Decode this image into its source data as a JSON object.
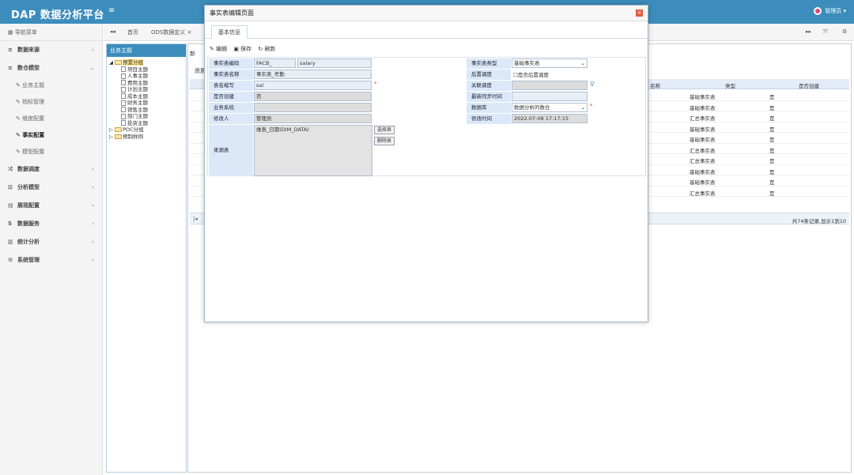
{
  "header": {
    "title": "DAP 数据分析平台",
    "menu_icon": "≡",
    "user": "管理员 ▾"
  },
  "sidebar": {
    "nav_label": "导航菜单",
    "items": [
      {
        "label": "数据来源",
        "icon": "≡"
      },
      {
        "label": "数仓模型",
        "icon": "≡"
      },
      {
        "label": "数据调度",
        "icon": "⤮"
      },
      {
        "label": "分析模型",
        "icon": "⊡"
      },
      {
        "label": "展现配置",
        "icon": "▤"
      },
      {
        "label": "数据服务",
        "icon": "S"
      },
      {
        "label": "统计分析",
        "icon": "▥"
      },
      {
        "label": "系统管理",
        "icon": "⚙"
      }
    ],
    "sub": [
      {
        "label": "业务主题"
      },
      {
        "label": "指标管理"
      },
      {
        "label": "维度配置"
      },
      {
        "label": "事实配置"
      },
      {
        "label": "模型配置"
      }
    ]
  },
  "tabs": {
    "nav_back": "◂◂",
    "home": "首页",
    "ods": "ODS数据定义 ×",
    "more": "▸▸",
    "expand": "⤧",
    "gear": "⚙"
  },
  "tree": {
    "header": "业务主题",
    "root": "预置分组",
    "children": [
      "项目主题",
      "人事主题",
      "费用主题",
      "计划主题",
      "成本主题",
      "财务主题",
      "销售主题",
      "部门主题",
      "投资主题"
    ],
    "poc": "POC分组",
    "sample": "预制样例"
  },
  "right": {
    "prefix_top": "新",
    "prefix_mid": "资质"
  },
  "grid": {
    "headers": {
      "name": "名称",
      "type": "类型",
      "summary": "是否创建"
    },
    "rows": [
      {
        "type": "基础事实表",
        "flag": "是"
      },
      {
        "type": "基础事实表",
        "flag": "是"
      },
      {
        "type": "汇总事实表",
        "flag": "是"
      },
      {
        "type": "基础事实表",
        "flag": "是"
      },
      {
        "type": "基础事实表",
        "flag": "是"
      },
      {
        "type": "汇总事实表",
        "flag": "是"
      },
      {
        "type": "汇总事实表",
        "flag": "是"
      },
      {
        "type": "基础事实表",
        "flag": "是"
      },
      {
        "type": "基础事实表",
        "flag": "是"
      },
      {
        "type": "汇总事实表",
        "flag": "是"
      }
    ],
    "pager_text": "共74条记录,显示1到10",
    "pager_first": "|◂"
  },
  "dialog": {
    "title": "事实表编辑页面",
    "close": "×",
    "tab": "基本信息",
    "toolbar": {
      "edit": "✎ 编辑",
      "save": "▣ 保存",
      "refresh": "↻ 刷新"
    },
    "labels": {
      "code": "事实表编码",
      "name": "事实表名称",
      "abbr": "表名缩写",
      "created": "是否创建",
      "biz": "业务系统",
      "modifier": "修改人",
      "source": "来源表",
      "type": "事实表类型",
      "delay": "后置调度",
      "assoc": "关联调度",
      "latest": "最新同步时间",
      "db": "数据库",
      "mtime": "修改时间"
    },
    "values": {
      "code_prefix": "FACB_",
      "code_suffix": "salary",
      "name": "事实表_考勤",
      "abbr": "sal",
      "created": "否",
      "biz": "",
      "modifier": "管理员",
      "source": "维表_日期(DIM_DATA)",
      "type": "基础事实表",
      "delay": "是否后置调度",
      "assoc": "",
      "latest": "",
      "db": "数据分析的数仓",
      "mtime": "2022-07-08 17:17:15"
    },
    "buttons": {
      "select": "选择表",
      "delete": "删除表"
    }
  }
}
